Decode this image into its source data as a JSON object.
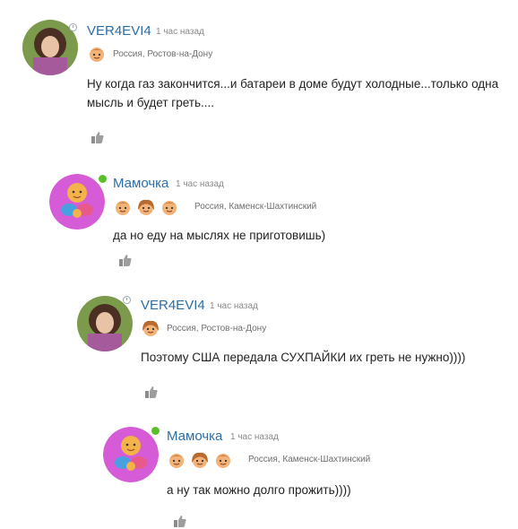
{
  "comments": [
    {
      "username": "VER4EVI4",
      "time": "1 час назад",
      "location": "Россия, Ростов-на-Дону",
      "text": "Ну когда газ закончится...и батареи в доме будут холодные...только одна мысль и будет греть....",
      "status": "away"
    },
    {
      "username": "Мамочка",
      "time": "1 час назад",
      "location": "Россия, Каменск-Шахтинский",
      "text": "да но еду на мыслях не приготовишь)",
      "status": "online"
    },
    {
      "username": "VER4EVI4",
      "time": "1 час назад",
      "location": "Россия, Ростов-на-Дону",
      "text": "Поэтому США передала СУХПАЙКИ их греть не нужно))))",
      "status": "away"
    },
    {
      "username": "Мамочка",
      "time": "1 час назад",
      "location": "Россия, Каменск-Шахтинский",
      "text": "а ну так можно долго прожить))))",
      "status": "online"
    }
  ],
  "icons": {
    "like": "thumbs-up-icon",
    "badge": "kid-face-icon",
    "away_status": "clock-status-icon",
    "online_status": "online-dot-icon"
  },
  "colors": {
    "username": "#2b6ea8",
    "online": "#5bbf2c",
    "avatar_pink": "#d65bd6"
  }
}
